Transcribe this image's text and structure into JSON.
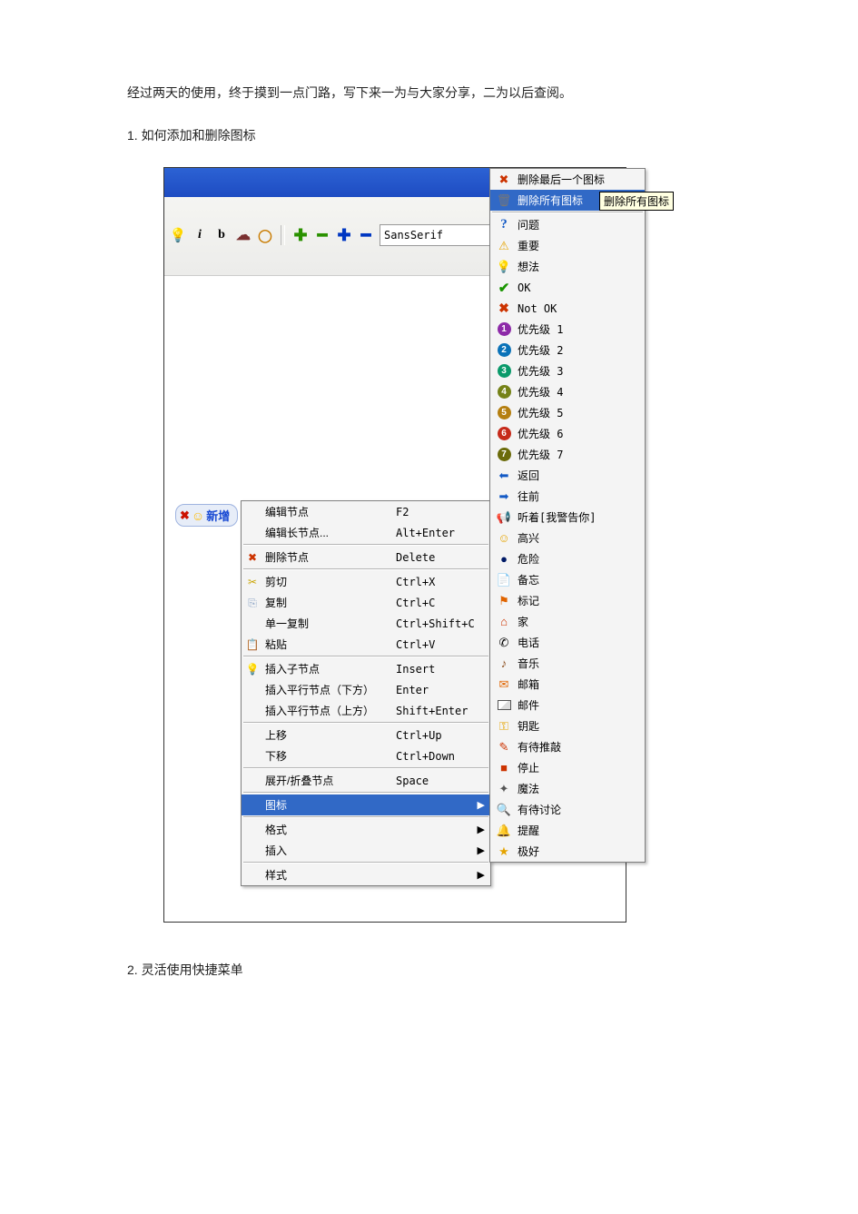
{
  "text": {
    "intro": "经过两天的使用，终于摸到一点门路，写下来一为与大家分享，二为以后查阅。",
    "sec1_num": "1.",
    "sec1_title": "如何添加和删除图标",
    "sec2_num": "2.",
    "sec2_title": "灵活使用快捷菜单"
  },
  "toolbar": {
    "font_value": "SansSerif"
  },
  "node": {
    "label": "新增"
  },
  "ctx": [
    {
      "icon": "",
      "label": "编辑节点",
      "shortcut": "F2"
    },
    {
      "icon": "",
      "label": "编辑长节点...",
      "shortcut": "Alt+Enter"
    },
    {
      "sep": true
    },
    {
      "icon": "xbox",
      "label": "删除节点",
      "shortcut": "Delete"
    },
    {
      "sep": true
    },
    {
      "icon": "cut",
      "label": "剪切",
      "shortcut": "Ctrl+X"
    },
    {
      "icon": "copy",
      "label": "复制",
      "shortcut": "Ctrl+C"
    },
    {
      "icon": "",
      "label": "单一复制",
      "shortcut": "Ctrl+Shift+C"
    },
    {
      "icon": "paste",
      "label": "粘贴",
      "shortcut": "Ctrl+V"
    },
    {
      "sep": true
    },
    {
      "icon": "bulb",
      "label": "插入子节点",
      "shortcut": "Insert"
    },
    {
      "icon": "",
      "label": "插入平行节点（下方）",
      "shortcut": "Enter"
    },
    {
      "icon": "",
      "label": "插入平行节点（上方）",
      "shortcut": "Shift+Enter"
    },
    {
      "sep": true
    },
    {
      "icon": "",
      "label": "上移",
      "shortcut": "Ctrl+Up"
    },
    {
      "icon": "",
      "label": "下移",
      "shortcut": "Ctrl+Down"
    },
    {
      "sep": true
    },
    {
      "icon": "",
      "label": "展开/折叠节点",
      "shortcut": "Space"
    },
    {
      "sep": true
    },
    {
      "icon": "",
      "label": "图标",
      "shortcut": "",
      "sub": true,
      "selected": true
    },
    {
      "sep": true
    },
    {
      "icon": "",
      "label": "格式",
      "shortcut": "",
      "sub": true
    },
    {
      "icon": "",
      "label": "插入",
      "shortcut": "",
      "sub": true
    },
    {
      "sep": true
    },
    {
      "icon": "",
      "label": "样式",
      "shortcut": "",
      "sub": true
    }
  ],
  "tooltip": "删除所有图标",
  "sub": [
    {
      "icon": "xred",
      "label": "删除最后一个图标"
    },
    {
      "icon": "trash",
      "label": "删除所有图标",
      "selected": true,
      "tooltip": true
    },
    {
      "sep": true
    },
    {
      "icon": "q",
      "label": "问题"
    },
    {
      "icon": "warn",
      "label": "重要"
    },
    {
      "icon": "bulb",
      "label": "想法"
    },
    {
      "icon": "ok",
      "label": "OK",
      "mono": true
    },
    {
      "icon": "nok",
      "label": "Not OK",
      "mono": true
    },
    {
      "icon": "p1",
      "label": "优先级 1"
    },
    {
      "icon": "p2",
      "label": "优先级 2"
    },
    {
      "icon": "p3",
      "label": "优先级 3"
    },
    {
      "icon": "p4",
      "label": "优先级 4"
    },
    {
      "icon": "p5",
      "label": "优先级 5"
    },
    {
      "icon": "p6",
      "label": "优先级 6"
    },
    {
      "icon": "p7",
      "label": "优先级 7"
    },
    {
      "icon": "back",
      "label": "返回"
    },
    {
      "icon": "fwd",
      "label": "往前"
    },
    {
      "icon": "ear",
      "label": "听着[我警告你]"
    },
    {
      "icon": "smile",
      "label": "高兴"
    },
    {
      "icon": "bomb",
      "label": "危险"
    },
    {
      "icon": "note",
      "label": "备忘"
    },
    {
      "icon": "flag",
      "label": "标记"
    },
    {
      "icon": "home",
      "label": "家"
    },
    {
      "icon": "phone",
      "label": "电话"
    },
    {
      "icon": "music",
      "label": "音乐"
    },
    {
      "icon": "mailbox",
      "label": "邮箱"
    },
    {
      "icon": "mail",
      "label": "邮件"
    },
    {
      "icon": "key",
      "label": "钥匙"
    },
    {
      "icon": "pen",
      "label": "有待推敲"
    },
    {
      "icon": "stop",
      "label": "停止"
    },
    {
      "icon": "wand",
      "label": "魔法"
    },
    {
      "icon": "lens",
      "label": "有待讨论"
    },
    {
      "icon": "bell",
      "label": "提醒"
    },
    {
      "icon": "star",
      "label": "极好"
    }
  ]
}
